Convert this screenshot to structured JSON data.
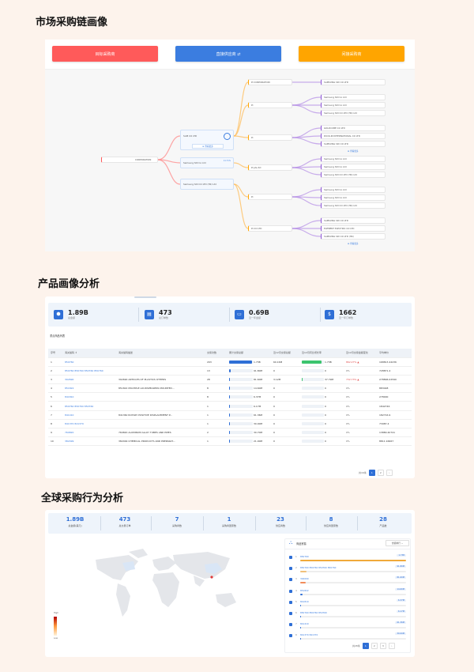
{
  "sections": {
    "supply_chain": {
      "title": "市场采购链画像"
    },
    "product": {
      "title": "产品画像分析"
    },
    "global": {
      "title": "全球采购行为分析"
    }
  },
  "supply_chain": {
    "tabs": [
      {
        "label": "目标采购商",
        "color": "#ff5a5a"
      },
      {
        "label": "直接供应商 ⇄",
        "color": "#3b7de0"
      },
      {
        "label": "间接采购商",
        "color": "#ffa500"
      }
    ],
    "center_node": "CORPORATION",
    "mid_nodes": [
      {
        "label": "SAM                 CO LTD"
      },
      {
        "label": "Samsung SDI Co Ltd",
        "badge": "11.71%"
      },
      {
        "label": "Samsung SDI CO LTD (HK) Ltd"
      }
    ],
    "mid_button": "☰ 查看更多",
    "branch_nodes": [
      "Pi                CORPORATION",
      "Pi                ",
      "Pi                ",
      "Pi                 pte ltd",
      "Pi                ",
      "Pi                 CO LTD"
    ],
    "leaf_groups": [
      [
        "SAMSUNG SDI CO LTD"
      ],
      [
        "Samsung SDI Co Ltd",
        "Samsung SDI Co Ltd",
        "Samsung SDI CO LTD (HK) Ltd"
      ],
      [
        "GOLDCUBE CO LTD",
        "DUCK-IN INTERNATIONAL CO LTD",
        "SAMSUNG SDI CO LTD"
      ],
      [
        "Samsung SDI Co Ltd",
        "Samsung SDI Co Ltd",
        "Samsung SDI CO LTD (HK) Ltd"
      ],
      [
        "Samsung SDI Co Ltd",
        "Samsung SDI Co Ltd",
        "Samsung SDI CO LTD (HK) Ltd"
      ],
      [
        "SAMSUNG SDI CO LTD",
        "ELEMENT ELECTRIC CO LTD",
        "SAMSUNG SDI CO LTD (HK)"
      ]
    ],
    "more_label": "☰ 查看更多"
  },
  "product": {
    "stats": [
      {
        "icon": "⬢",
        "value": "1.89B",
        "label": "总金额"
      },
      {
        "icon": "▤",
        "value": "473",
        "label": "总订单数"
      },
      {
        "icon": "▭",
        "value": "0.69B",
        "label": "近一年金额"
      },
      {
        "icon": "$",
        "value": "1662",
        "label": "近一年订单数"
      }
    ],
    "table_title": "重点商品列表",
    "columns": [
      "序号",
      "海关编码 ↕",
      "海关编码描述",
      "交易次数",
      "累计交易总额",
      "近12月交易总额",
      "近12月同比增长率",
      "近12月交易金额变化",
      "平均单价"
    ],
    "rows": [
      {
        "i": "1",
        "code": "850760",
        "desc": "",
        "cnt": "293",
        "total": "1.73B",
        "y12": "60.16M",
        "yoy": "1.73B",
        "chg": "862.27% ▲",
        "avg": "168813.44236",
        "bar": 0.95,
        "g": 0.9
      },
      {
        "i": "2",
        "code": "850760 850760 850760 850760",
        "desc": "",
        "cnt": "13",
        "total": "91.80M",
        "y12": "0",
        "yoy": "0",
        "chg": "0%",
        "avg": "728871.4",
        "bar": 0.05,
        "g": 0
      },
      {
        "i": "3",
        "code": "392690",
        "desc": "392690 ARTICLES OF PLASTICS OTHERS",
        "cnt": "28",
        "total": "81.60M",
        "y12": "3.12M",
        "yoy": "37.79M",
        "chg": "732.73% ▲",
        "avg": "278896.02590",
        "bar": 0.04,
        "g": 0.05
      },
      {
        "i": "4",
        "code": "851822",
        "desc": "851822 MULTIPLE LOUDSPEAKERS MOUNTED...",
        "cnt": "8",
        "total": "14.60M",
        "y12": "0",
        "yoy": "0",
        "chg": "0%",
        "avg": "883448",
        "bar": 0.02,
        "g": 0
      },
      {
        "i": "5",
        "code": "841810",
        "desc": "",
        "cnt": "8",
        "total": "6.37M",
        "y12": "0",
        "yoy": "0",
        "chg": "0%",
        "avg": "278000",
        "bar": 0.01,
        "g": 0
      },
      {
        "i": "6",
        "code": "850760 850760 850760",
        "desc": "",
        "cnt": "1",
        "total": "6.17M",
        "y12": "0",
        "yoy": "0",
        "chg": "0%",
        "avg": "1842746",
        "bar": 0.01,
        "g": 0
      },
      {
        "i": "7",
        "code": "841410",
        "desc": "841360 ROTARY POSITIVE DISPLACEMENT P...",
        "cnt": "1",
        "total": "61.36M",
        "y12": "0",
        "yoy": "0",
        "chg": "0%",
        "avg": "182716.9",
        "bar": 0.01,
        "g": 0
      },
      {
        "i": "8",
        "code": "841370 841370",
        "desc": "",
        "cnt": "1",
        "total": "30.00M",
        "y12": "0",
        "yoy": "0",
        "chg": "0%",
        "avg": "73987.4",
        "bar": 0.01,
        "g": 0
      },
      {
        "i": "9",
        "code": "760820",
        "desc": "760820 ALUMINUM ALLOY TUBES AND PIPES",
        "cnt": "2",
        "total": "30.70M",
        "y12": "0",
        "yoy": "0",
        "chg": "0%",
        "avg": "13880.40741",
        "bar": 0.01,
        "g": 0
      },
      {
        "i": "10",
        "code": "382499",
        "desc": "382499 CHEMICAL PRODUCTS AND PREPARAT...",
        "cnt": "1",
        "total": "21.00M",
        "y12": "0",
        "yoy": "0",
        "chg": "0%",
        "avg": "8811.16667",
        "bar": 0.01,
        "g": 0
      }
    ],
    "pager": {
      "total": "共16条",
      "pages": [
        "1",
        "2"
      ],
      "next": "›"
    }
  },
  "global": {
    "stats": [
      {
        "value": "1.89B",
        "label": "总金额(美元)"
      },
      {
        "value": "473",
        "label": "总交易订单"
      },
      {
        "value": "7",
        "label": "采购商数"
      },
      {
        "value": "1",
        "label": "采购商国家数"
      },
      {
        "value": "23",
        "label": "供应商数"
      },
      {
        "value": "8",
        "label": "供应商国家数"
      },
      {
        "value": "28",
        "label": "产品数"
      }
    ],
    "legend": {
      "high": "High",
      "low": "Low"
    },
    "rank": {
      "title": "商品贸易",
      "select": "金额排行 ⌄",
      "items": [
        {
          "i": "1",
          "name": "850760",
          "val": "1.73B",
          "pct": 1.0,
          "color": "#f0a93a"
        },
        {
          "i": "2",
          "name": "850760 850760 850760 850760",
          "val": "91.80M",
          "pct": 0.06,
          "color": "#f0c07a"
        },
        {
          "i": "3",
          "name": "392690",
          "val": "81.60M",
          "pct": 0.05,
          "color": "#f28c5a"
        },
        {
          "i": "4",
          "name": "851822",
          "val": "14.60M",
          "pct": 0.02,
          "color": "#2f6fd6"
        },
        {
          "i": "5",
          "name": "841810",
          "val": "6.37M",
          "pct": 0.01,
          "color": "#2f6fd6"
        },
        {
          "i": "6",
          "name": "850760 850760 850760",
          "val": "6.17M",
          "pct": 0.01,
          "color": "#2f6fd6"
        },
        {
          "i": "7",
          "name": "841410",
          "val": "61.36M",
          "pct": 0.01,
          "color": "#2f6fd6"
        },
        {
          "i": "8",
          "name": "841370 841370",
          "val": "30.00M",
          "pct": 0.01,
          "color": "#2f6fd6"
        }
      ],
      "pager": {
        "total": "共28条",
        "pages": [
          "1",
          "2",
          "3"
        ],
        "next": "›"
      }
    }
  }
}
